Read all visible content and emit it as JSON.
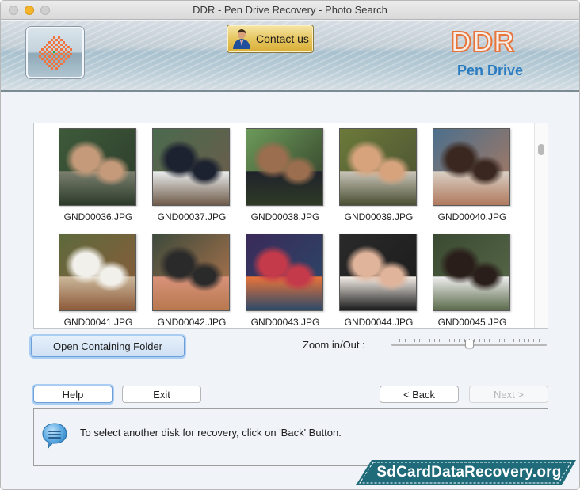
{
  "window": {
    "title": "DDR - Pen Drive Recovery - Photo Search",
    "controls": [
      "close",
      "minimize",
      "zoom"
    ]
  },
  "header": {
    "logo_icon": "ddr-checker-logo-icon",
    "contact_button": {
      "label": "Contact us",
      "icon": "person-support-icon"
    },
    "brand": {
      "name": "DDR",
      "product": "Pen Drive",
      "name_color": "#e8743a",
      "product_color": "#2a7bc0"
    }
  },
  "gallery": {
    "items": [
      {
        "filename": "GND00036.JPG",
        "palette": [
          "#3e5a3a",
          "#7a7f6e",
          "#c49a7a",
          "#2c3b2a"
        ]
      },
      {
        "filename": "GND00037.JPG",
        "palette": [
          "#4a6a4e",
          "#e9ecec",
          "#1d2230",
          "#6f5b4a"
        ]
      },
      {
        "filename": "GND00038.JPG",
        "palette": [
          "#6c9a5a",
          "#20232b",
          "#9a6e4e",
          "#2e3a26"
        ]
      },
      {
        "filename": "GND00039.JPG",
        "palette": [
          "#6b7a3a",
          "#c8c4b8",
          "#d6a37d",
          "#4a4f32"
        ]
      },
      {
        "filename": "GND00040.JPG",
        "palette": [
          "#4c6f8c",
          "#d9cfc4",
          "#3a2820",
          "#b07a5e"
        ]
      },
      {
        "filename": "GND00041.JPG",
        "palette": [
          "#5e6a3c",
          "#cbb79a",
          "#f2f0ea",
          "#8c5a3a"
        ]
      },
      {
        "filename": "GND00042.JPG",
        "palette": [
          "#3d4a3c",
          "#d8927a",
          "#2a2a2a",
          "#b8784e"
        ]
      },
      {
        "filename": "GND00043.JPG",
        "palette": [
          "#3a2a5a",
          "#e8743a",
          "#c43a4a",
          "#2a4a6a"
        ]
      },
      {
        "filename": "GND00044.JPG",
        "palette": [
          "#2a2a2a",
          "#f2ece6",
          "#e0b49a",
          "#1a1a1a"
        ]
      },
      {
        "filename": "GND00045.JPG",
        "palette": [
          "#3a4a32",
          "#eeeeee",
          "#2a1e1a",
          "#5a6a4a"
        ]
      }
    ],
    "scrollbar_position": 0.08
  },
  "actions": {
    "open_folder_label": "Open Containing Folder",
    "zoom_label": "Zoom in/Out :",
    "zoom_level": 0.5
  },
  "nav": {
    "help_label": "Help",
    "exit_label": "Exit",
    "back_label": "< Back",
    "next_label": "Next >",
    "next_enabled": false
  },
  "info": {
    "icon": "speech-bubble-icon",
    "message": "To select another disk for recovery, click on 'Back' Button."
  },
  "watermark": {
    "text": "SdCardDataRecovery.org",
    "color": "#1f6b7a"
  }
}
